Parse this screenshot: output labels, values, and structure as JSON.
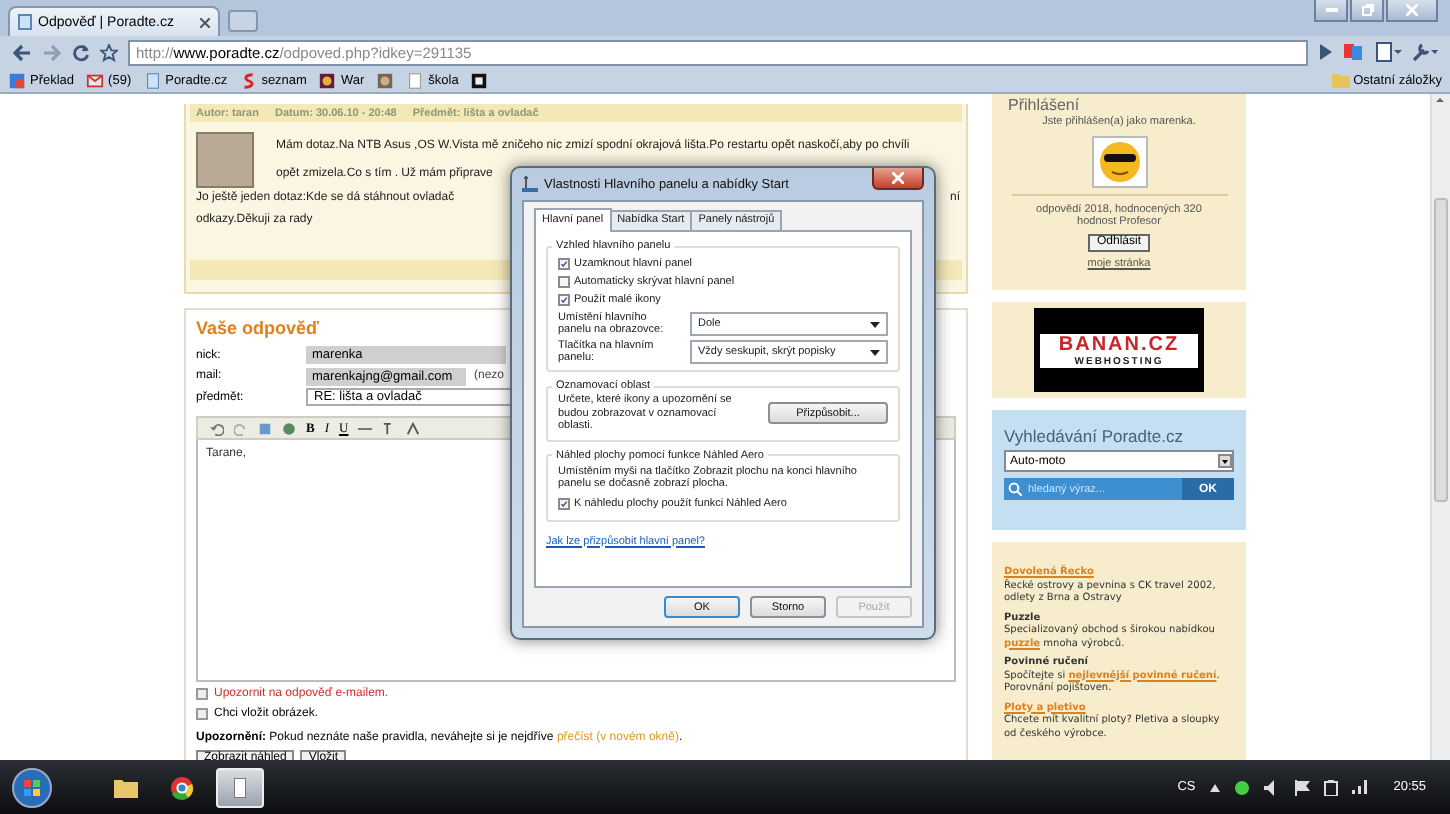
{
  "browser": {
    "tab_title": "Odpověď | Poradte.cz",
    "url_scheme": "http://",
    "url_host": "www.poradte.cz",
    "url_path": "/odpoved.php?idkey=291135",
    "bookmarks": [
      {
        "label": "Překlad",
        "kind": "translate"
      },
      {
        "label": "(59)",
        "kind": "mail"
      },
      {
        "label": "Poradte.cz",
        "kind": "page"
      },
      {
        "label": "seznam",
        "kind": "seznam"
      },
      {
        "label": "War",
        "kind": "game"
      },
      {
        "kind": "photo"
      },
      {
        "label": "škola",
        "kind": "doc"
      },
      {
        "kind": "dark"
      }
    ],
    "other_bookmarks": "Ostatní záložky"
  },
  "post": {
    "meta": [
      "Autor: taran",
      "Datum: 30.06.10 - 20:48",
      "Předmět: lišta a ovladač"
    ],
    "lines": [
      "Mám dotaz.Na NTB Asus ,OS W.Vista mě zničeho nic zmizí spodní okrajová lišta.Po restartu opět naskočí,aby po chvíli",
      "opět zmizela.Co s tím . Už mám připrave"
    ],
    "lines_2": [
      "Jo ještě jeden dotaz:Kde se dá stáhnout ovladač",
      "odkazy.Děkuji za rady"
    ],
    "line_end": "ní"
  },
  "reply": {
    "title": "Vaše odpověď",
    "fields": [
      {
        "label": "nick:",
        "value": "marenka",
        "kind": "filled"
      },
      {
        "label": "mail:",
        "value": "marenkajng@gmail.com",
        "kind": "filled",
        "note": "(nezo"
      },
      {
        "label": "předmět:",
        "value": "RE: lišta a ovladač",
        "kind": "plain"
      }
    ],
    "toolbar": [
      "B",
      "I",
      "U"
    ],
    "editor_text": "Tarane,",
    "options": [
      {
        "label": "Upozornit na odpověď e-mailem.",
        "checked": false,
        "kind": "alert"
      },
      {
        "label": "Chci vložit obrázek.",
        "checked": false,
        "kind": "plain"
      }
    ],
    "notice": "**Upozornění:** Pokud neznáte naše pravidla, neváhejte si je nejdříve",
    "notice_link": "přečíst (v novém okně)",
    "notice_end": ".",
    "buttons": [
      "Zobrazit náhled",
      "Vložit"
    ]
  },
  "sidebar": {
    "login": {
      "title": "Přihlášení",
      "status": "Jste přihlášen(a) jako marenka.",
      "stats": "odpovědí 2018, hodnocených 320",
      "rank": "hodnost Profesor",
      "logout": "Odhlásit",
      "profile_link": "moje stránka"
    },
    "banner": {
      "brand": "BANAN.CZ",
      "tagline": "WEBHOSTING"
    },
    "search": {
      "title": "Vyhledávání Poradte.cz",
      "category": "Auto-moto",
      "placeholder": "hledaný výraz...",
      "button": "OK"
    },
    "ads": [
      {
        "title": "Dovolená Řecko",
        "kind": "link",
        "text": "Řecké ostrovy a pevnina s CK travel 2002, odlety z Brna a Ostravy"
      },
      {
        "title": "Puzzle",
        "kind": "bold",
        "text": "Specializovaný obchod s širokou nabídkou",
        "link": "puzzle",
        "text_end": "mnoha výrobců."
      },
      {
        "title": "Povinné ručení",
        "kind": "bold",
        "text": "Spočítejte si",
        "link": "nejlevnější povinné ručení",
        "text_end": ". Porovnání pojištoven."
      },
      {
        "title": "Ploty a pletivo",
        "kind": "link",
        "text": "Chcete mít kvalitní ploty? Pletiva a sloupky od českého výrobce."
      }
    ]
  },
  "dialog": {
    "title": "Vlastnosti Hlavního panelu a nabídky Start",
    "tabs": [
      {
        "label": "Hlavní panel",
        "selected": true
      },
      {
        "label": "Nabídka Start",
        "selected": false
      },
      {
        "label": "Panely nástrojů",
        "selected": false
      }
    ],
    "appearance": {
      "title": "Vzhled hlavního panelu",
      "checkboxes": [
        {
          "label": "Uzamknout hlavní panel",
          "checked": true
        },
        {
          "label": "Automaticky skrývat hlavní panel",
          "checked": false
        },
        {
          "label": "Použít malé ikony",
          "checked": true
        }
      ],
      "selects": [
        {
          "label": "Umístění hlavního panelu na obrazovce:",
          "value": "Dole"
        },
        {
          "label": "Tlačítka na hlavním panelu:",
          "value": "Vždy seskupit, skrýt popisky"
        }
      ]
    },
    "notification": {
      "title": "Oznamovací oblast",
      "text": "Určete, které ikony a upozornění se budou zobrazovat v oznamovací oblasti.",
      "button": "Přizpůsobit..."
    },
    "peek": {
      "title": "Náhled plochy pomocí funkce Náhled Aero",
      "text": "Umístěním myši na tlačítko Zobrazit plochu na konci hlavního panelu se dočasně zobrazí plocha.",
      "checkbox": {
        "label": "K náhledu plochy použít funkci Náhled Aero",
        "checked": true
      }
    },
    "help_link": "Jak lze přizpůsobit hlavní panel?",
    "buttons": [
      {
        "label": "OK",
        "disabled": false
      },
      {
        "label": "Storno",
        "disabled": false
      },
      {
        "label": "Použít",
        "disabled": true
      }
    ]
  },
  "taskbar": {
    "language": "CS",
    "clock": "20:55"
  }
}
